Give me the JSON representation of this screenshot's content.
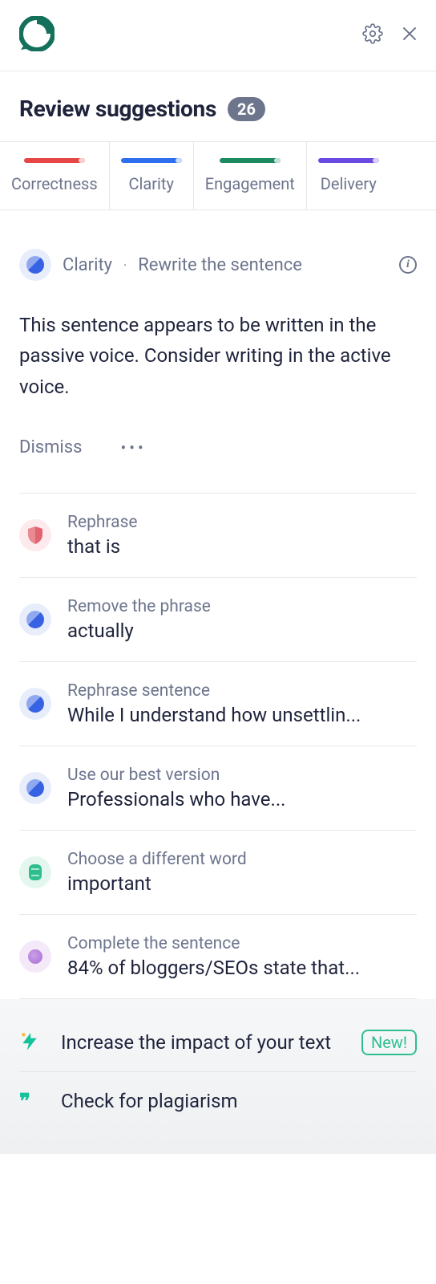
{
  "header": {
    "title": "Review suggestions",
    "count": "26"
  },
  "tabs": [
    {
      "label": "Correctness",
      "color": "#e64646"
    },
    {
      "label": "Clarity",
      "color": "#2f6fed"
    },
    {
      "label": "Engagement",
      "color": "#1e8a5f"
    },
    {
      "label": "Delivery",
      "color": "#6a4ae3"
    }
  ],
  "expanded": {
    "category": "Clarity",
    "hint": "Rewrite the sentence",
    "body": "This sentence appears to be written in the passive voice. Consider writing in the active voice.",
    "dismiss": "Dismiss"
  },
  "suggestions": [
    {
      "icon": "correct",
      "hint": "Rephrase",
      "content": "that is"
    },
    {
      "icon": "clarity",
      "hint": "Remove the phrase",
      "content": "actually"
    },
    {
      "icon": "clarity",
      "hint": "Rephrase sentence",
      "content": "While I understand how unsettlin..."
    },
    {
      "icon": "clarity",
      "hint": "Use our best version",
      "content": "Professionals who have..."
    },
    {
      "icon": "engage",
      "hint": "Choose a different word",
      "content": "important"
    },
    {
      "icon": "delivery",
      "hint": "Complete the sentence",
      "content": "84% of bloggers/SEOs state that..."
    }
  ],
  "footer": {
    "impact": "Increase the impact of your text",
    "impact_badge": "New!",
    "plagiarism": "Check for plagiarism"
  }
}
